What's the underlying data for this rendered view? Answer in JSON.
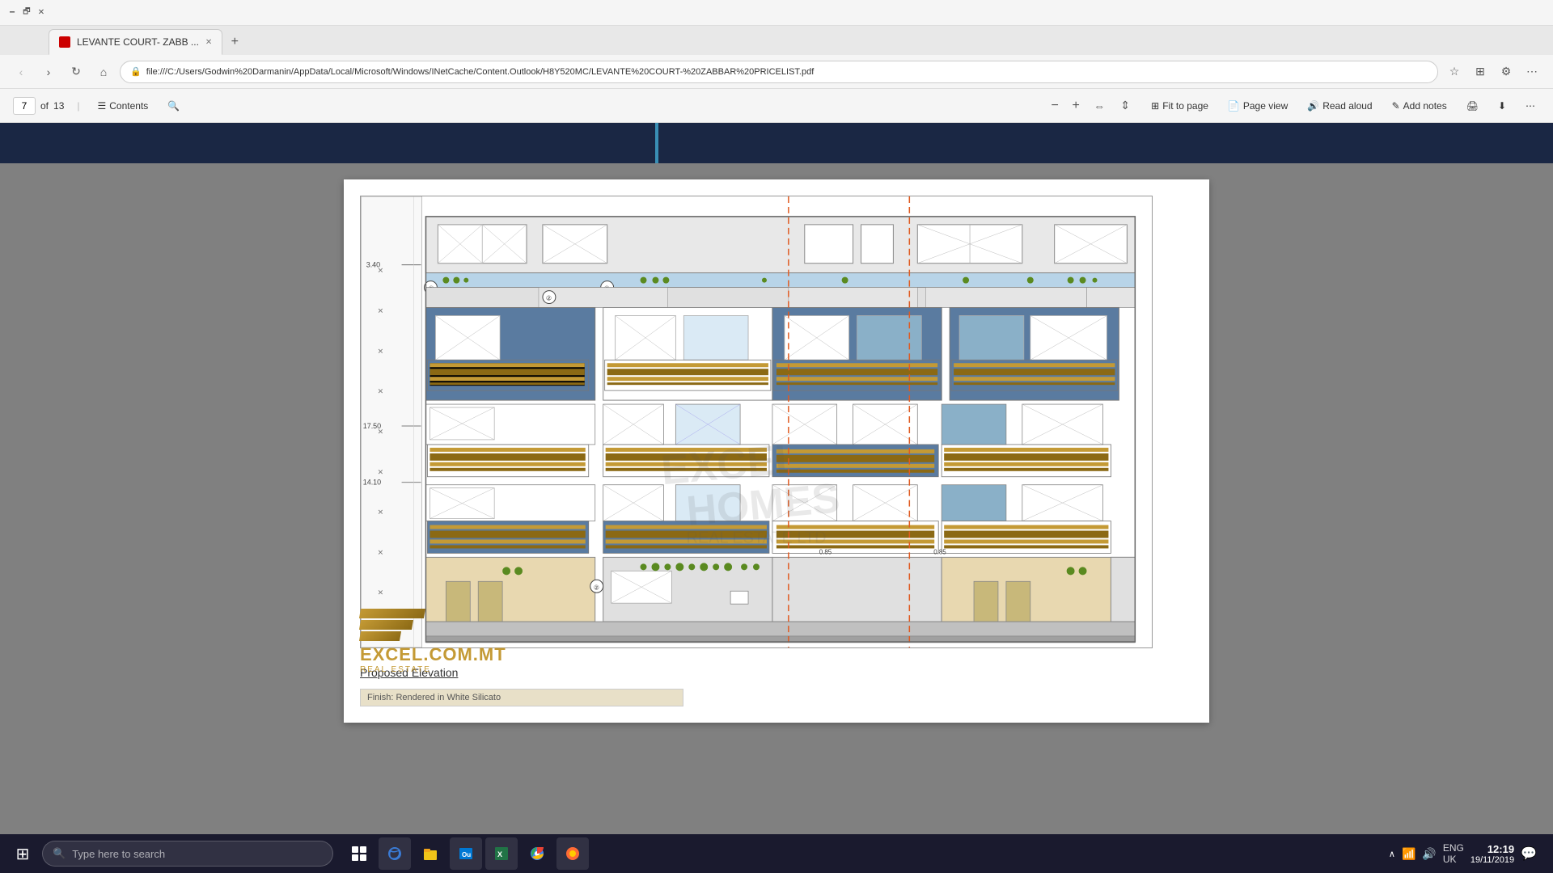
{
  "browser": {
    "title": "LEVANTE COURT- ZABB",
    "tab_label": "LEVANTE COURT- ZABB ...",
    "address": "file:///C:/Users/Godwin%20Darmanin/AppData/Local/Microsoft/Windows/INetCache/Content.Outlook/H8Y520MC/LEVANTE%20COURT-%20ZABBAR%20PRICELIST.pdf",
    "close_icon": "✕",
    "back_icon": "‹",
    "forward_icon": "›",
    "refresh_icon": "↻",
    "home_icon": "⌂",
    "new_tab_icon": "+"
  },
  "pdf_toolbar": {
    "page_current": "7",
    "page_total": "13",
    "contents_label": "Contents",
    "zoom_out": "−",
    "zoom_in": "+",
    "fit_to_page": "Fit to page",
    "page_view": "Page view",
    "read_aloud": "Read aloud",
    "add_notes": "Add notes",
    "print_icon": "🖨",
    "rotate_icon": "↻"
  },
  "drawing": {
    "title": "Proposed Elevation",
    "legend_text": "Finish: Rendered in White Silicato",
    "scale_values": [
      "3.40",
      "17.50",
      "14.10"
    ],
    "watermark_line1": "EXCEL",
    "watermark_line2": "HOMES",
    "watermark_sub": "REAL ESTATE LTD",
    "dim_085": "0.85",
    "dim_085b": "0.85"
  },
  "logo": {
    "main": "EXCEL.COM.MT",
    "tagline": "REAL ESTATE"
  },
  "taskbar": {
    "search_placeholder": "Type here to search",
    "time": "12:19",
    "date": "19/11/2019",
    "language": "ENG",
    "region": "UK",
    "start_icon": "⊞"
  }
}
